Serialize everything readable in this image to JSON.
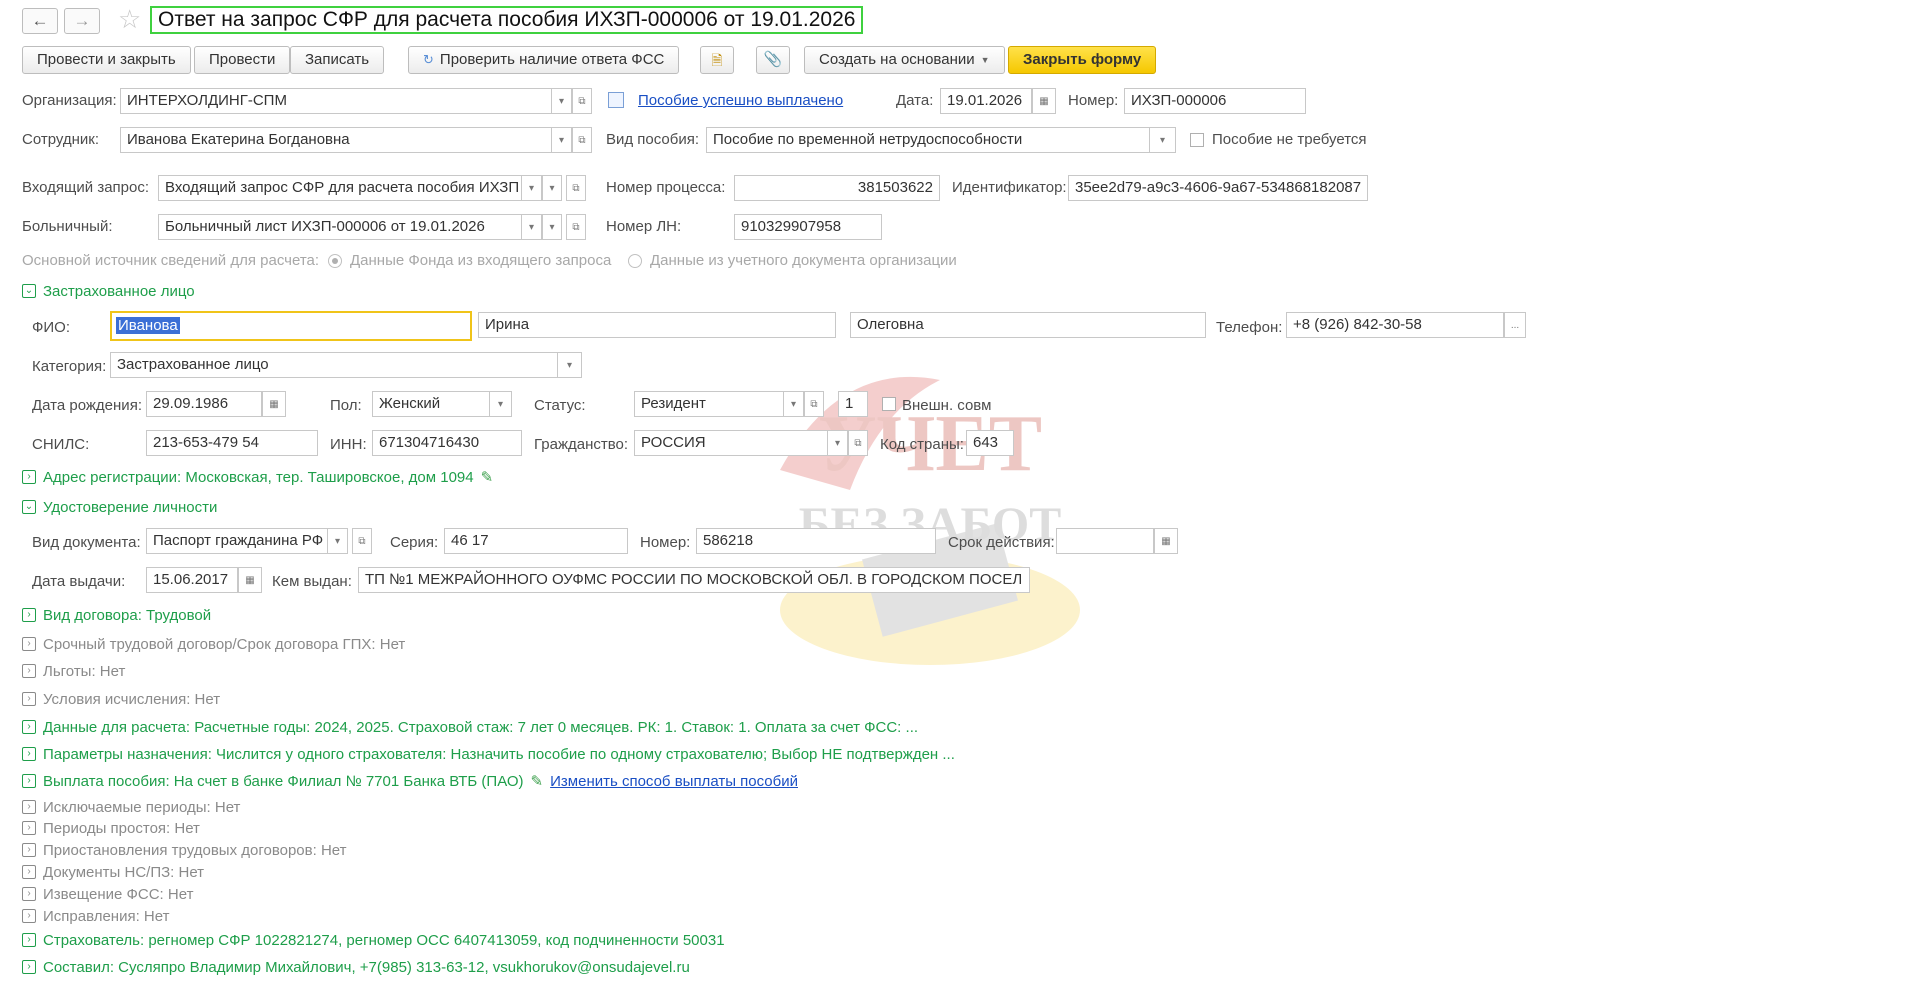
{
  "window": {
    "title": "Ответ на запрос СФР для расчета пособия ИХЗП-000006 от 19.01.2026"
  },
  "toolbar": {
    "post_close": "Провести и закрыть",
    "post": "Провести",
    "save": "Записать",
    "check_fss": "Проверить наличие ответа ФСС",
    "create_based": "Создать на основании",
    "close_form": "Закрыть форму"
  },
  "header": {
    "org_label": "Организация:",
    "org_value": "ИНТЕРХОЛДИНГ-СПМ",
    "status_link": "Пособие успешно выплачено",
    "date_label": "Дата:",
    "date_value": "19.01.2026",
    "number_label": "Номер:",
    "number_value": "ИХЗП-000006",
    "employee_label": "Сотрудник:",
    "employee_value": "Иванова Екатерина Богдановна",
    "benefit_type_label": "Вид пособия:",
    "benefit_type_value": "Пособие по временной нетрудоспособности",
    "not_required_label": "Пособие не требуется",
    "incoming_label": "Входящий запрос:",
    "incoming_value": "Входящий запрос СФР для расчета пособия ИХЗП",
    "process_label": "Номер процесса:",
    "process_value": "381503622",
    "id_label": "Идентификатор:",
    "id_value": "35ee2d79-a9c3-4606-9a67-534868182087",
    "sick_label": "Больничный:",
    "sick_value": "Больничный лист ИХЗП-000006 от 19.01.2026",
    "ln_label": "Номер ЛН:",
    "ln_value": "910329907958",
    "source_label": "Основной источник сведений для расчета:",
    "source_opt1": "Данные Фонда из входящего запроса",
    "source_opt2": "Данные из учетного документа организации"
  },
  "insured": {
    "section_title": "Застрахованное лицо",
    "fio_label": "ФИО:",
    "last_name": "Иванова",
    "first_name": "Ирина",
    "middle_name": "Олеговна",
    "phone_label": "Телефон:",
    "phone_value": "+8 (926) 842-30-58",
    "category_label": "Категория:",
    "category_value": "Застрахованное лицо",
    "birth_label": "Дата рождения:",
    "birth_value": "29.09.1986",
    "gender_label": "Пол:",
    "gender_value": "Женский",
    "status_label": "Статус:",
    "status_value": "Резидент",
    "status_num": "1",
    "ext_label": "Внешн. совм",
    "snils_label": "СНИЛС:",
    "snils_value": "213-653-479 54",
    "inn_label": "ИНН:",
    "inn_value": "671304716430",
    "citizen_label": "Гражданство:",
    "citizen_value": "РОССИЯ",
    "country_label": "Код страны:",
    "country_value": "643",
    "address": "Адрес регистрации: Московская, тер. Ташировское, дом 1094"
  },
  "identity": {
    "section_title": "Удостоверение личности",
    "doc_label": "Вид документа:",
    "doc_value": "Паспорт гражданина РФ",
    "series_label": "Серия:",
    "series_value": "46 17",
    "number_label": "Номер:",
    "number_value": "586218",
    "valid_label": "Срок действия:",
    "issue_date_label": "Дата выдачи:",
    "issue_date_value": "15.06.2017",
    "issued_by_label": "Кем выдан:",
    "issued_by_value": "ТП №1 МЕЖРАЙОННОГО ОУФМС РОССИИ ПО МОСКОВСКОЙ ОБЛ. В ГОРОДСКОМ ПОСЕЛ"
  },
  "sections": {
    "contract": "Вид договора: Трудовой",
    "fixed_term": "Срочный трудовой договор/Срок договора ГПХ: Нет",
    "benefits": "Льготы: Нет",
    "calc_conditions": "Условия исчисления: Нет",
    "calc_data": "Данные для расчета: Расчетные годы: 2024, 2025. Страховой стаж: 7 лет  0 месяцев. РК: 1. Ставок: 1. Оплата за счет ФСС: ...",
    "params": "Параметры назначения: Числится у одного страхователя: Назначить пособие по одному страхователю; Выбор НЕ подтвержден ...",
    "payment": "Выплата пособия: На счет в банке Филиал № 7701 Банка ВТБ (ПАО)",
    "payment_link": "Изменить способ выплаты пособий",
    "excluded": "Исключаемые периоды: Нет",
    "downtime": "Периоды простоя: Нет",
    "suspensions": "Приостановления трудовых договоров: Нет",
    "ns_docs": "Документы НС/ПЗ: Нет",
    "fss_notice": "Извещение ФСС: Нет",
    "corrections": "Исправления: Нет",
    "insurer": "Страхователь: регномер СФР 1022821274, регномер ОСС 6407413059, код подчиненности 50031",
    "author": "Составил: Сусляпро Владимир Михайлович, +7(985) 313-63-12, vsukhorukov@onsudajevel.ru"
  },
  "watermark": {
    "line1": "УЧЕТ",
    "line2": "БЕЗ ЗАБОТ"
  },
  "colors": {
    "accent_green": "#1e9e4a",
    "focus_yellow": "#f0c419",
    "close_button": "#f5c800",
    "link_blue": "#1a4fc4"
  }
}
